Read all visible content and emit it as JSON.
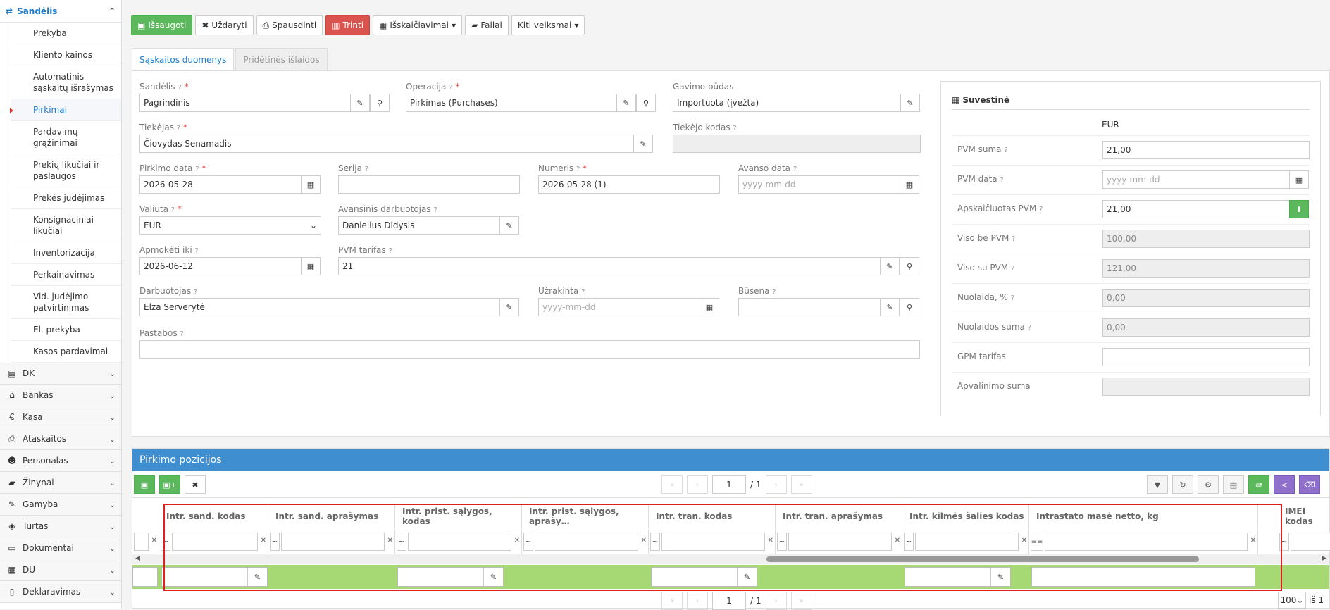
{
  "sidebar": {
    "section_title": "Sandėlis",
    "sub_items": [
      {
        "label": "Prekyba"
      },
      {
        "label": "Kliento kainos"
      },
      {
        "label": "Automatinis sąskaitų išrašymas"
      },
      {
        "label": "Pirkimai"
      },
      {
        "label": "Pardavimų grąžinimai"
      },
      {
        "label": "Prekių likučiai ir paslaugos"
      },
      {
        "label": "Prekės judėjimas"
      },
      {
        "label": "Konsignaciniai likučiai"
      },
      {
        "label": "Inventorizacija"
      },
      {
        "label": "Perkainavimas"
      },
      {
        "label": "Vid. judėjimo patvirtinimas"
      },
      {
        "label": "El. prekyba"
      },
      {
        "label": "Kasos pardavimai"
      }
    ],
    "main_items": [
      {
        "label": "DK",
        "icon": "book-icon"
      },
      {
        "label": "Bankas",
        "icon": "bank-icon"
      },
      {
        "label": "Kasa",
        "icon": "euro-icon"
      },
      {
        "label": "Ataskaitos",
        "icon": "printer-icon"
      },
      {
        "label": "Personalas",
        "icon": "users-icon"
      },
      {
        "label": "Žinynai",
        "icon": "folder-icon"
      },
      {
        "label": "Gamyba",
        "icon": "wrench-icon"
      },
      {
        "label": "Turtas",
        "icon": "cube-icon"
      },
      {
        "label": "Dokumentai",
        "icon": "inbox-icon"
      },
      {
        "label": "DU",
        "icon": "table-icon"
      },
      {
        "label": "Deklaravimas",
        "icon": "file-icon"
      }
    ]
  },
  "toolbar": {
    "save": "Išsaugoti",
    "close": "Uždaryti",
    "print": "Spausdinti",
    "delete": "Trinti",
    "calculations": "Išskaičiavimai",
    "files": "Failai",
    "other": "Kiti veiksmai"
  },
  "tabs": {
    "invoice_data": "Sąskaitos duomenys",
    "additional_costs": "Pridėtinės išlaidos"
  },
  "form": {
    "warehouse": {
      "label": "Sandėlis",
      "value": "Pagrindinis"
    },
    "operation": {
      "label": "Operacija",
      "value": "Pirkimas  (Purchases)"
    },
    "receipt_method": {
      "label": "Gavimo būdas",
      "value": "Importuota (įvežta)"
    },
    "supplier": {
      "label": "Tiekėjas",
      "value": "Čiovydas Senamadis"
    },
    "supplier_code": {
      "label": "Tiekėjo kodas",
      "value": ""
    },
    "purchase_date": {
      "label": "Pirkimo data",
      "value": "2026-05-28"
    },
    "series": {
      "label": "Serija",
      "value": ""
    },
    "number": {
      "label": "Numeris",
      "value": "2026-05-28 (1)"
    },
    "advance_date": {
      "label": "Avanso data",
      "placeholder": "yyyy-mm-dd"
    },
    "currency": {
      "label": "Valiuta",
      "value": "EUR"
    },
    "advance_employee": {
      "label": "Avansinis darbuotojas",
      "value": "Danielius Didysis"
    },
    "pay_until": {
      "label": "Apmokėti iki",
      "value": "2026-06-12"
    },
    "vat_rate": {
      "label": "PVM tarifas",
      "value": "21"
    },
    "employee": {
      "label": "Darbuotojas",
      "value": "Elza Serverytė"
    },
    "locked": {
      "label": "Užrakinta",
      "placeholder": "yyyy-mm-dd"
    },
    "status": {
      "label": "Būsena",
      "value": ""
    },
    "notes": {
      "label": "Pastabos",
      "value": ""
    }
  },
  "summary": {
    "title": "Suvestinė",
    "currency": "EUR",
    "rows": [
      {
        "label": "PVM suma",
        "value": "21,00"
      },
      {
        "label": "PVM data",
        "placeholder": "yyyy-mm-dd"
      },
      {
        "label": "Apskaičiuotas PVM",
        "value": "21,00"
      },
      {
        "label": "Viso be PVM",
        "value": "100,00"
      },
      {
        "label": "Viso su PVM",
        "value": "121,00"
      },
      {
        "label": "Nuolaida, %",
        "value": "0,00"
      },
      {
        "label": "Nuolaidos suma",
        "value": "0,00"
      },
      {
        "label": "GPM tarifas",
        "value": ""
      },
      {
        "label": "Apvalinimo suma",
        "value": ""
      }
    ]
  },
  "positions": {
    "title": "Pirkimo pozicijos",
    "page": "1",
    "page_total": "/ 1",
    "per_page": "100",
    "per_page_suffix": "iš 1",
    "columns": [
      "Intr. sand. kodas",
      "Intr. sand. aprašymas",
      "Intr. prist. sąlygos, kodas",
      "Intr. prist. sąlygos, aprašy…",
      "Intr. tran. kodas",
      "Intr. tran. aprašymas",
      "Intr. kilmės šalies kodas",
      "Intrastato masė netto, kg",
      "IMEI kodas"
    ],
    "filter_ops": [
      "~",
      "~",
      "~",
      "~",
      "~",
      "~",
      "~",
      "==",
      "~"
    ]
  }
}
